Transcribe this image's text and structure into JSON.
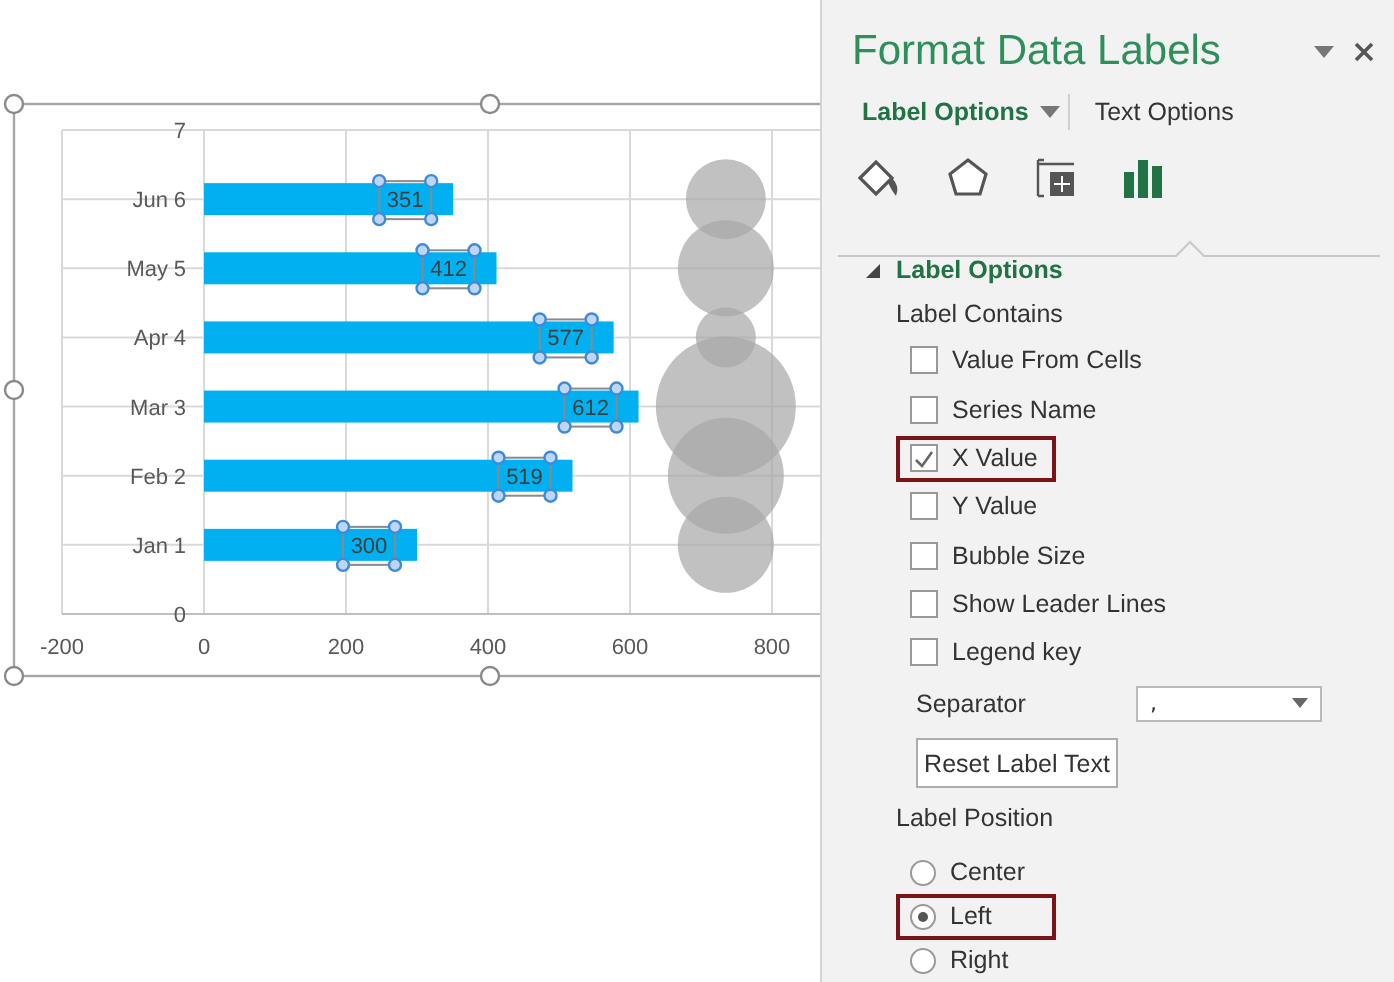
{
  "chart": {
    "chart_data": {
      "type": "bar",
      "orientation": "horizontal",
      "categories": [
        "Jun",
        "May",
        "Apr",
        "Mar",
        "Feb",
        "Jan"
      ],
      "series": [
        {
          "color": "#00b0f0",
          "values": [
            351,
            412,
            577,
            612,
            519,
            300
          ]
        }
      ],
      "xlim": [
        -200,
        800
      ],
      "xticks": [
        -200,
        0,
        200,
        400,
        600,
        800
      ],
      "grid": true,
      "data_labels": true
    },
    "y_axis_labels": [
      "7",
      "6",
      "5",
      "4",
      "3",
      "2",
      "1",
      "0"
    ]
  },
  "panel": {
    "title": "Format Data Labels",
    "tabs": [
      {
        "label": "Label Options",
        "selected": true
      },
      {
        "label": "Text Options",
        "selected": false
      }
    ],
    "icon_tabs": [
      {
        "kind": "fill",
        "selected": false
      },
      {
        "kind": "effects",
        "selected": false
      },
      {
        "kind": "size",
        "selected": false
      },
      {
        "kind": "chart",
        "selected": true
      }
    ],
    "section": {
      "title": "Label Options",
      "expanded": true
    },
    "contains_label": "Label Contains",
    "checkboxes": [
      {
        "label": "Value From Cells",
        "checked": false,
        "highlighted": false
      },
      {
        "label": "Series Name",
        "checked": false,
        "highlighted": false
      },
      {
        "label": "X Value",
        "checked": true,
        "highlighted": true
      },
      {
        "label": "Y Value",
        "checked": false,
        "highlighted": false
      },
      {
        "label": "Bubble Size",
        "checked": false,
        "highlighted": false
      },
      {
        "label": "Show Leader Lines",
        "checked": false,
        "highlighted": false
      },
      {
        "label": "Legend key",
        "checked": false,
        "highlighted": false
      }
    ],
    "separator": {
      "label": "Separator",
      "value": ","
    },
    "reset_button": "Reset Label Text",
    "position_label": "Label Position",
    "positions": [
      {
        "label": "Center",
        "selected": false,
        "highlighted": false
      },
      {
        "label": "Left",
        "selected": true,
        "highlighted": true
      },
      {
        "label": "Right",
        "selected": false,
        "highlighted": false
      }
    ]
  }
}
